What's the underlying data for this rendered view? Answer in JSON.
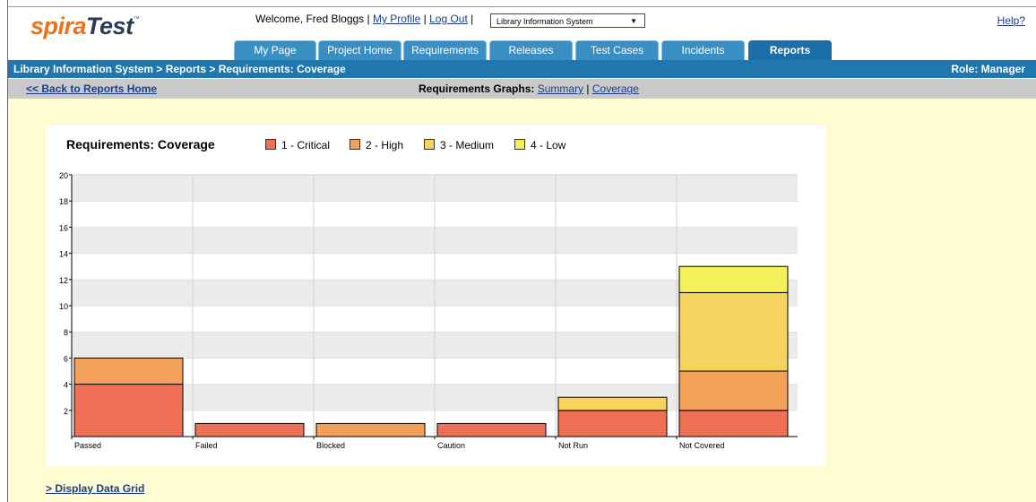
{
  "header": {
    "logo_part1": "spira",
    "logo_part2": "Test",
    "logo_tm": "™",
    "welcome_text": "Welcome, Fred Bloggs",
    "my_profile": "My Profile",
    "log_out": "Log Out",
    "project_select": "Library Information System",
    "help": "Help?"
  },
  "tabs": [
    {
      "label": "My Page"
    },
    {
      "label": "Project Home"
    },
    {
      "label": "Requirements"
    },
    {
      "label": "Releases"
    },
    {
      "label": "Test Cases"
    },
    {
      "label": "Incidents"
    },
    {
      "label": "Reports",
      "active": true
    }
  ],
  "breadcrumb": "Library Information System > Reports > Requirements: Coverage",
  "role": "Role: Manager",
  "subnav": {
    "back": "<< Back to Reports Home",
    "graphs_label": "Requirements Graphs:",
    "summary": "Summary",
    "coverage": "Coverage"
  },
  "display_grid": "> Display Data Grid",
  "colors": {
    "critical": "#f07055",
    "high": "#f3a05a",
    "medium": "#f5d35e",
    "low": "#f4f05a",
    "tab": "#3a8fc2",
    "bar_blue": "#1f77ad"
  },
  "chart_data": {
    "type": "bar",
    "stacked": true,
    "title": "Requirements: Coverage",
    "categories": [
      "Passed",
      "Failed",
      "Blocked",
      "Caution",
      "Not Run",
      "Not Covered"
    ],
    "series": [
      {
        "name": "1 - Critical",
        "values": [
          4,
          1,
          0,
          1,
          2,
          2
        ]
      },
      {
        "name": "2 - High",
        "values": [
          2,
          0,
          1,
          0,
          0,
          3
        ]
      },
      {
        "name": "3 - Medium",
        "values": [
          0,
          0,
          0,
          0,
          1,
          6
        ]
      },
      {
        "name": "4 - Low",
        "values": [
          0,
          0,
          0,
          0,
          0,
          2
        ]
      }
    ],
    "ylim": [
      0,
      20
    ],
    "yticks": [
      2,
      4,
      6,
      8,
      10,
      12,
      14,
      16,
      18,
      20
    ],
    "grid": true,
    "legend": "top"
  }
}
